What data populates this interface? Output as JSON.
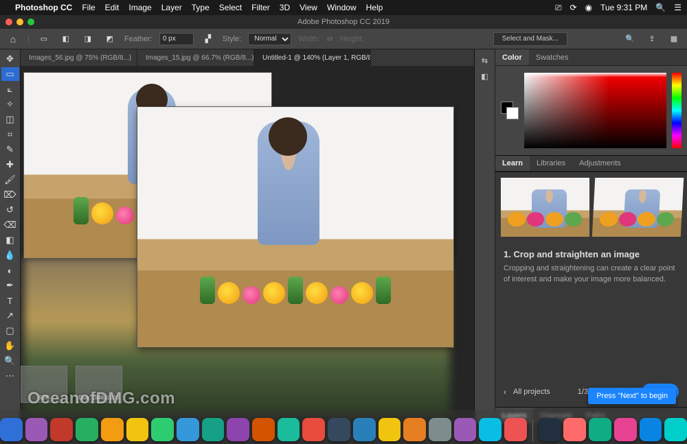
{
  "mac_menu": {
    "app": "Photoshop CC",
    "items": [
      "File",
      "Edit",
      "Image",
      "Layer",
      "Type",
      "Select",
      "Filter",
      "3D",
      "View",
      "Window",
      "Help"
    ],
    "clock": "Tue 9:31 PM"
  },
  "window_title": "Adobe Photoshop CC 2019",
  "options_bar": {
    "feather_label": "Feather:",
    "feather_value": "0 px",
    "style_label": "Style:",
    "style_value": "Normal",
    "width_label": "Width:",
    "height_label": "Height:",
    "mask_btn": "Select and Mask..."
  },
  "doc_tabs": [
    {
      "label": "Images_56.jpg @ 75% (RGB/8...)",
      "active": false
    },
    {
      "label": "Images_15.jpg @ 66.7% (RGB/8...)",
      "active": false
    },
    {
      "label": "Untitled-1 @ 140% (Layer 1, RGB/8*) *",
      "active": true
    }
  ],
  "color_panel": {
    "tab1": "Color",
    "tab2": "Swatches"
  },
  "learn_panel": {
    "tab1": "Learn",
    "tab2": "Libraries",
    "tab3": "Adjustments",
    "title": "1.  Crop and straighten an image",
    "body": "Cropping and straightening can create a clear point of interest and make your image more balanced.",
    "back": "All projects",
    "step": "1/3",
    "next": "Next",
    "hint": "Press \"Next\" to begin"
  },
  "bottom_panel": {
    "tab1": "Layers",
    "tab2": "Channels",
    "tab3": "Paths"
  },
  "desk": {
    "file1_label": "92%",
    "file2_label": "Duo: 1846x1230"
  },
  "watermark": "OceanofDMG.com",
  "dock_colors": [
    "#2f6fd8",
    "#9B59B6",
    "#c0392b",
    "#27ae60",
    "#f39c12",
    "#f1c40f",
    "#2ecc71",
    "#3498db",
    "#16a085",
    "#8e44ad",
    "#d35400",
    "#1abc9c",
    "#e74c3c",
    "#34495e",
    "#2980b9",
    "#f1c40f",
    "#e67e22",
    "#7f8c8d",
    "#9b59b6",
    "#0abde3",
    "#ee5253",
    "#222f3e",
    "#ff6b6b",
    "#10ac84",
    "#e84393",
    "#0984e3",
    "#00cec9"
  ]
}
